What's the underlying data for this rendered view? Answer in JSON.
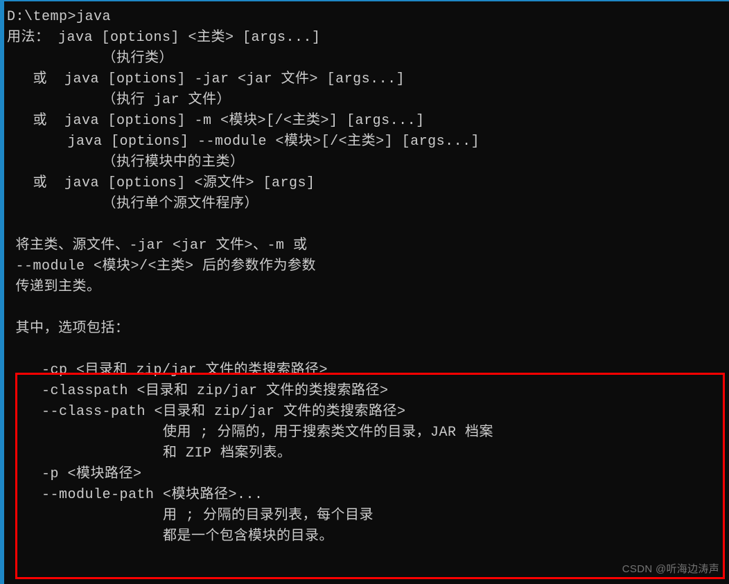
{
  "terminal": {
    "lines": [
      "D:\\temp>java",
      "用法： java [options] <主类> [args...]",
      "           （执行类）",
      "   或  java [options] -jar <jar 文件> [args...]",
      "           （执行 jar 文件）",
      "   或  java [options] -m <模块>[/<主类>] [args...]",
      "       java [options] --module <模块>[/<主类>] [args...]",
      "           （执行模块中的主类）",
      "   或  java [options] <源文件> [args]",
      "           （执行单个源文件程序）",
      "",
      " 将主类、源文件、-jar <jar 文件>、-m 或",
      " --module <模块>/<主类> 后的参数作为参数",
      " 传递到主类。",
      "",
      " 其中，选项包括：",
      "",
      "    -cp <目录和 zip/jar 文件的类搜索路径>",
      "    -classpath <目录和 zip/jar 文件的类搜索路径>",
      "    --class-path <目录和 zip/jar 文件的类搜索路径>",
      "                  使用 ; 分隔的，用于搜索类文件的目录，JAR 档案",
      "                  和 ZIP 档案列表。",
      "    -p <模块路径>",
      "    --module-path <模块路径>...",
      "                  用 ; 分隔的目录列表，每个目录",
      "                  都是一个包含模块的目录。"
    ]
  },
  "watermark": "CSDN @听海边涛声"
}
